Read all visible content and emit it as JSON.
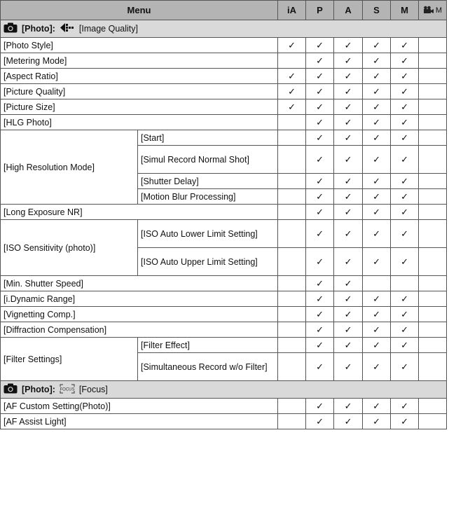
{
  "header": {
    "menu": "Menu",
    "modes": [
      "iA",
      "P",
      "A",
      "S",
      "M",
      "M"
    ]
  },
  "check": "✓",
  "sections": [
    {
      "photo_label": "[Photo]:",
      "icon": "image-quality-icon",
      "name": "[Image Quality]"
    },
    {
      "photo_label": "[Photo]:",
      "icon": "focus-icon",
      "icon_text": "FOCUS",
      "name": "[Focus]"
    }
  ],
  "rows": {
    "photo_style": {
      "label": "[Photo Style]",
      "checks": [
        true,
        true,
        true,
        true,
        true,
        false
      ]
    },
    "metering_mode": {
      "label": "[Metering Mode]",
      "checks": [
        false,
        true,
        true,
        true,
        true,
        false
      ]
    },
    "aspect_ratio": {
      "label": "[Aspect Ratio]",
      "checks": [
        true,
        true,
        true,
        true,
        true,
        false
      ]
    },
    "picture_quality": {
      "label": "[Picture Quality]",
      "checks": [
        true,
        true,
        true,
        true,
        true,
        false
      ]
    },
    "picture_size": {
      "label": "[Picture Size]",
      "checks": [
        true,
        true,
        true,
        true,
        true,
        false
      ]
    },
    "hlg_photo": {
      "label": "[HLG Photo]",
      "checks": [
        false,
        true,
        true,
        true,
        true,
        false
      ]
    },
    "high_res": {
      "label": "[High Resolution Mode]",
      "subs": [
        {
          "label": "[Start]",
          "checks": [
            false,
            true,
            true,
            true,
            true,
            false
          ]
        },
        {
          "label": "[Simul Record Normal Shot]",
          "checks": [
            false,
            true,
            true,
            true,
            true,
            false
          ]
        },
        {
          "label": "[Shutter Delay]",
          "checks": [
            false,
            true,
            true,
            true,
            true,
            false
          ]
        },
        {
          "label": "[Motion Blur Processing]",
          "checks": [
            false,
            true,
            true,
            true,
            true,
            false
          ]
        }
      ]
    },
    "long_exposure": {
      "label": "[Long Exposure NR]",
      "checks": [
        false,
        true,
        true,
        true,
        true,
        false
      ]
    },
    "iso_sensitivity": {
      "label": "[ISO Sensitivity (photo)]",
      "subs": [
        {
          "label": "[ISO Auto Lower Limit Setting]",
          "checks": [
            false,
            true,
            true,
            true,
            true,
            false
          ]
        },
        {
          "label": "[ISO Auto Upper Limit Setting]",
          "checks": [
            false,
            true,
            true,
            true,
            true,
            false
          ]
        }
      ]
    },
    "min_shutter": {
      "label": "[Min. Shutter Speed]",
      "checks": [
        false,
        true,
        true,
        false,
        false,
        false
      ]
    },
    "i_dynamic": {
      "label": "[i.Dynamic Range]",
      "checks": [
        false,
        true,
        true,
        true,
        true,
        false
      ]
    },
    "vignetting": {
      "label": "[Vignetting Comp.]",
      "checks": [
        false,
        true,
        true,
        true,
        true,
        false
      ]
    },
    "diffraction": {
      "label": "[Diffraction Compensation]",
      "checks": [
        false,
        true,
        true,
        true,
        true,
        false
      ]
    },
    "filter_settings": {
      "label": "[Filter Settings]",
      "subs": [
        {
          "label": "[Filter Effect]",
          "checks": [
            false,
            true,
            true,
            true,
            true,
            false
          ]
        },
        {
          "label": "[Simultaneous Record w/o Filter]",
          "checks": [
            false,
            true,
            true,
            true,
            true,
            false
          ]
        }
      ]
    },
    "af_custom": {
      "label": "[AF Custom Setting(Photo)]",
      "checks": [
        false,
        true,
        true,
        true,
        true,
        false
      ]
    },
    "af_assist": {
      "label": "[AF Assist Light]",
      "checks": [
        false,
        true,
        true,
        true,
        true,
        false
      ]
    }
  }
}
